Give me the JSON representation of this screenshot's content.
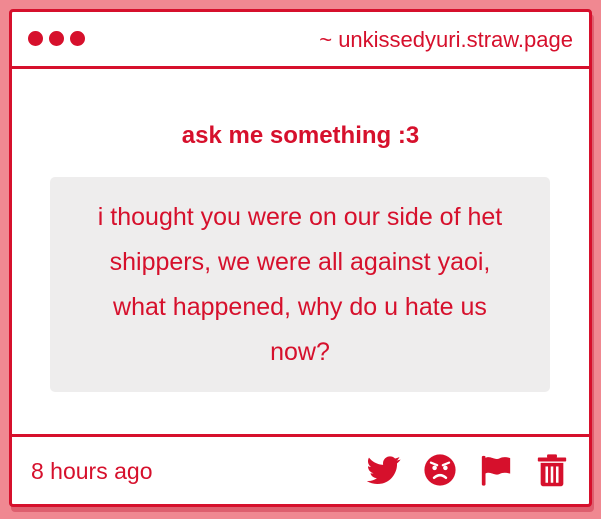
{
  "header": {
    "url": "~ unkissedyuri.straw.page"
  },
  "main": {
    "title": "ask me something :3",
    "question": "i thought you were on our side of het shippers, we were all against yaoi, what happened, why do u hate us now?"
  },
  "footer": {
    "timestamp": "8 hours ago",
    "actions": [
      {
        "icon": "twitter-icon"
      },
      {
        "icon": "angry-face-icon"
      },
      {
        "icon": "flag-icon"
      },
      {
        "icon": "trash-icon"
      }
    ]
  },
  "colors": {
    "accent": "#d6102c",
    "background": "#f08891",
    "question_bg": "#eeeded"
  }
}
